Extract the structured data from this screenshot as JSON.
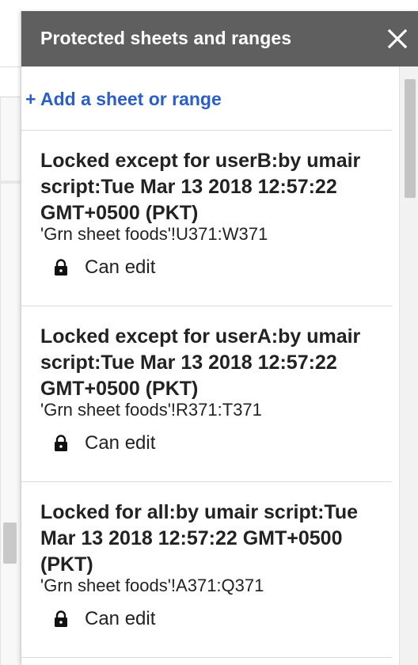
{
  "panel": {
    "title": "Protected sheets and ranges",
    "close_icon": "close-icon",
    "add_label": "+ Add a sheet or range"
  },
  "protections": [
    {
      "description": "Locked except for userB:by umair script:Tue Mar 13 2018 12:57:22 GMT+0500 (PKT)",
      "range": "'Grn sheet foods'!U371:W371",
      "permission": "Can edit",
      "icon": "lock-icon"
    },
    {
      "description": "Locked except for userA:by umair script:Tue Mar 13 2018 12:57:22 GMT+0500 (PKT)",
      "range": "'Grn sheet foods'!R371:T371",
      "permission": "Can edit",
      "icon": "lock-icon"
    },
    {
      "description": "Locked for all:by umair script:Tue Mar 13 2018 12:57:22 GMT+0500 (PKT)",
      "range": "'Grn sheet foods'!A371:Q371",
      "permission": "Can edit",
      "icon": "lock-icon"
    }
  ],
  "colors": {
    "header_bg": "#5f5f5f",
    "link": "#2a5ec8",
    "text": "#222222"
  }
}
